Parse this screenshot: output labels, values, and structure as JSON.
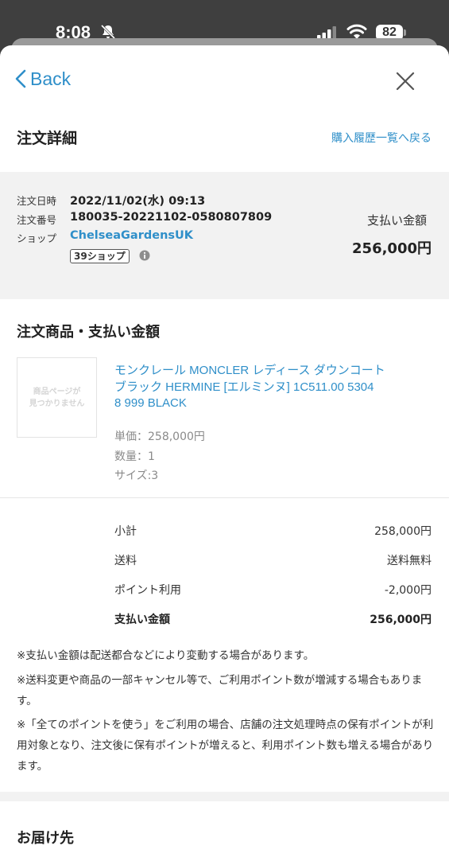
{
  "status_bar": {
    "time": "8:08",
    "battery": "82"
  },
  "nav": {
    "back_label": "Back"
  },
  "header": {
    "title": "注文詳細",
    "history_link": "購入履歴一覧へ戻る"
  },
  "order": {
    "date_label": "注文日時",
    "date_value": "2022/11/02(水) 09:13",
    "number_label": "注文番号",
    "number_value": "180035-20221102-0580807809",
    "shop_label": "ショップ",
    "shop_value": "ChelseaGardensUK",
    "shop_tag": "39ショップ",
    "payment_label": "支払い金額",
    "payment_value": "256,000円"
  },
  "products_section": {
    "title": "注文商品・支払い金額",
    "image_placeholder_line1": "商品ページが",
    "image_placeholder_line2": "見つかりません",
    "product_name_lines": [
      "モンクレール MONCLER レディース ダウンコート",
      "ブラック HERMINE [エルミンヌ] 1C511.00 5304",
      "8 999 BLACK"
    ],
    "unit_price": "単価：258,000円",
    "quantity": "数量：1",
    "size": "サイズ:3"
  },
  "summary": {
    "rows": [
      {
        "label": "小計",
        "value": "258,000円"
      },
      {
        "label": "送料",
        "value": "送料無料"
      },
      {
        "label": "ポイント利用",
        "value": "-2,000円"
      },
      {
        "label": "支払い金額",
        "value": "256,000円"
      }
    ]
  },
  "notes": [
    "※支払い金額は配送都合などにより変動する場合があります。",
    "※送料変更や商品の一部キャンセル等で、ご利用ポイント数が増減する場合もあります。",
    "※「全てのポイントを使う」をご利用の場合、店舗の注文処理時点の保有ポイントが利用対象となり、注文後に保有ポイントが増えると、利用ポイント数も増える場合があります。"
  ],
  "delivery_section": {
    "title": "お届け先"
  },
  "colors": {
    "link": "#2f8fc9",
    "panel": "#f2f2f2"
  },
  "icons": [
    "bell-slash-icon",
    "signal-icon",
    "wifi-icon",
    "chevron-left-icon",
    "close-icon",
    "info-icon"
  ]
}
